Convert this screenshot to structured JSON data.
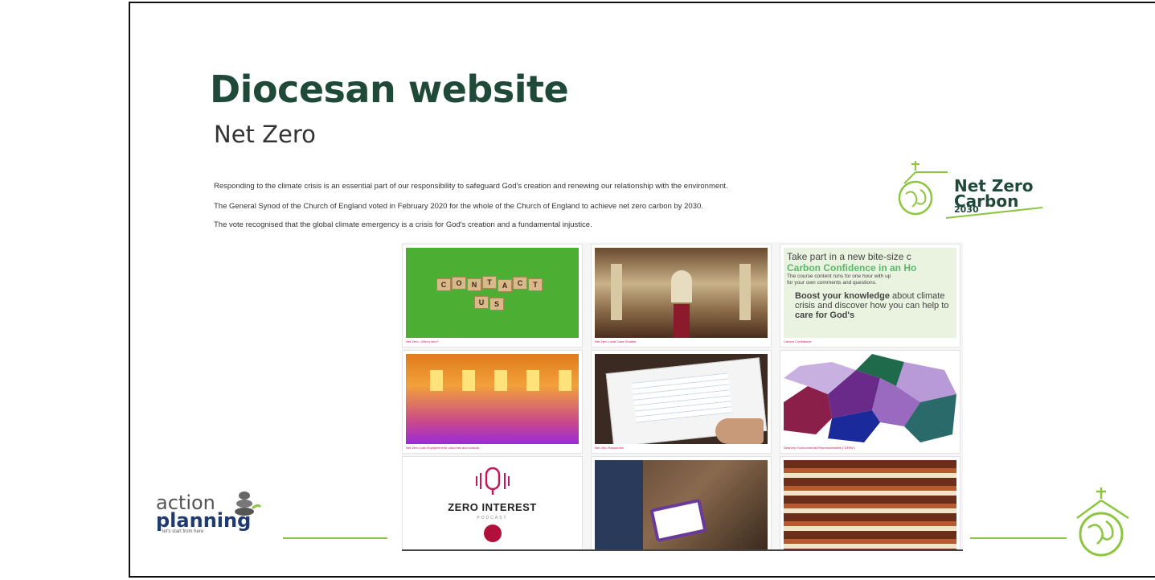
{
  "slide": {
    "title": "Diocesan website",
    "subtitle": "Net Zero",
    "paragraphs": [
      "Responding to the climate crisis is an essential part of our responsibility to safeguard God's creation and renewing our relationship with the environment.",
      "The General Synod of the Church of England voted in February 2020 for the whole of the Church of England to achieve net zero carbon by 2030.",
      "The vote recognised that the global climate emergency is a crisis for God's creation and a fundamental injustice."
    ]
  },
  "nz_logo": {
    "line1": "Net Zero",
    "line2": "Carbon",
    "year": "2030",
    "icon": "church-globe-icon"
  },
  "tiles": [
    {
      "caption": "Net Zero - Who's who?",
      "image": "contact-us-scrabble",
      "letters1": [
        "C",
        "O",
        "N",
        "T",
        "A",
        "C",
        "T"
      ],
      "letters2": [
        "U",
        "S"
      ]
    },
    {
      "caption": "Net Zero Local Case Studies",
      "image": "church-interior"
    },
    {
      "caption": "Carbon Confidence",
      "image": "carbon-confidence-banner",
      "banner": {
        "line1": "Take part in a new bite-size c",
        "line2": "Carbon Confidence in an Ho",
        "line3": "The course content runs for one hour with up",
        "line4": "for your own comments and questions.",
        "bold": "Boost your knowledge",
        "rest": " about climate crisis and discover how you can help to ",
        "bold2": "care for God's"
      }
    },
    {
      "caption": "Net Zero Loan Equipment for churches and schools",
      "image": "thermal-building"
    },
    {
      "caption": "Net Zero Resources",
      "image": "tablet-spreadsheet"
    },
    {
      "caption": "Deanery Environmental Representatives (\"DERs\")",
      "image": "deanery-map"
    },
    {
      "caption": "",
      "image": "zero-interest-podcast",
      "podcast_title": "ZERO INTEREST",
      "podcast_sub": "PODCAST"
    },
    {
      "caption": "",
      "image": "tablet-church"
    },
    {
      "caption": "",
      "image": "church-pews"
    }
  ],
  "footer": {
    "brand_line1": "action",
    "brand_line2": "planning",
    "tagline": "let's start from here",
    "colors": {
      "accent": "#8cc63f",
      "title": "#1f4a3a",
      "link": "#c2185b"
    }
  }
}
